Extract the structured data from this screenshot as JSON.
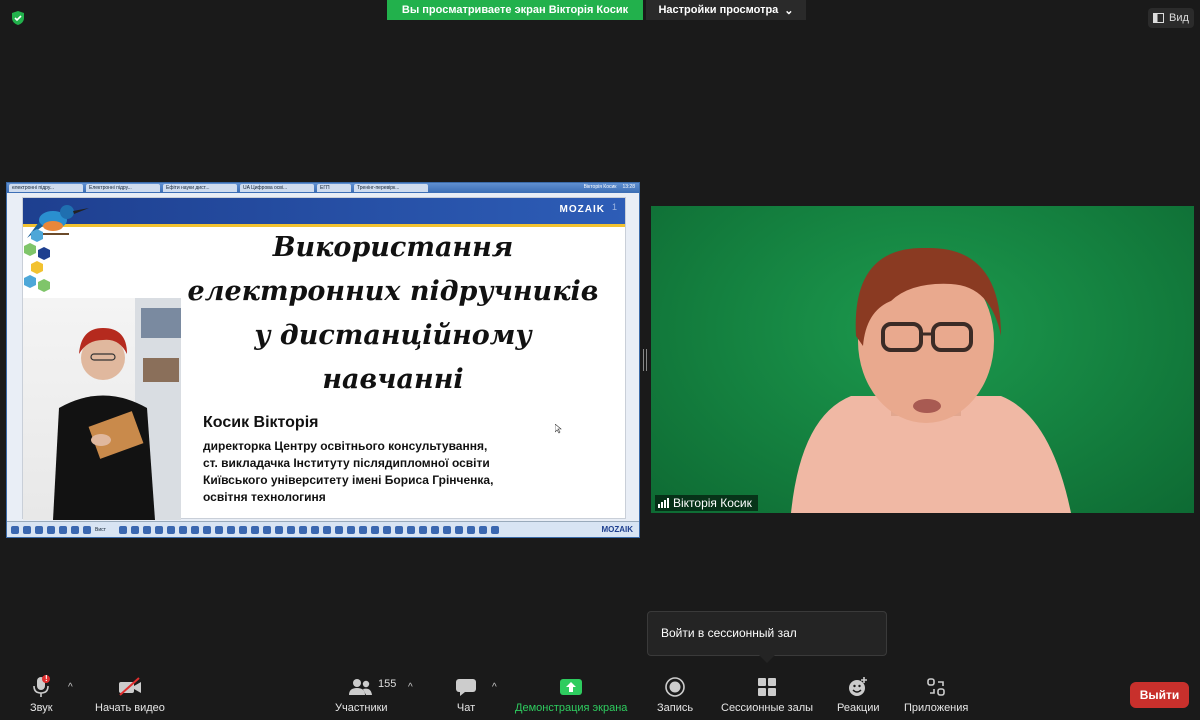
{
  "top_bar": {
    "share_banner": "Вы просматриваете экран Вікторія Косик",
    "view_options": "Настройки просмотра",
    "view_button": "Вид"
  },
  "shared_screen": {
    "browser_tabs": [
      "електронні підру...",
      "Електронні підру...",
      "Ефіти науки дист...",
      "UA Цифрова осві...",
      "ЕГП",
      "Тренінг-перевірк..."
    ],
    "taskbar_right": [
      "Вікторія Косик",
      "13:28"
    ],
    "slide": {
      "brand": "MOZAIK",
      "page_number": "1",
      "title_lines": [
        "Використання",
        "електронних підручників",
        "у дистанційному",
        "навчанні"
      ],
      "author": "Косик Вікторія",
      "affiliation_lines": [
        "директорка Центру освітнього консультування,",
        "ст. викладачка Інституту післядипломної освіти",
        "Київського університету імені Бориса Грінченка,",
        "освітня технологиня"
      ]
    },
    "bottom_brand": "MOZAIK",
    "bottom_zoom": "Вист"
  },
  "video": {
    "participant_name": "Вікторія Косик"
  },
  "tooltip": {
    "text": "Войти в сессионный зал"
  },
  "toolbar": {
    "audio": "Звук",
    "video": "Начать видео",
    "participants": "Участники",
    "participants_count": "155",
    "chat": "Чат",
    "share": "Демонстрация экрана",
    "record": "Запись",
    "breakout": "Сессионные залы",
    "reactions": "Реакции",
    "apps": "Приложения",
    "leave": "Выйти",
    "audio_badge": "!"
  },
  "colors": {
    "accent_green": "#22b14c",
    "leave_red": "#c8302c",
    "background": "#1a1a1a"
  }
}
